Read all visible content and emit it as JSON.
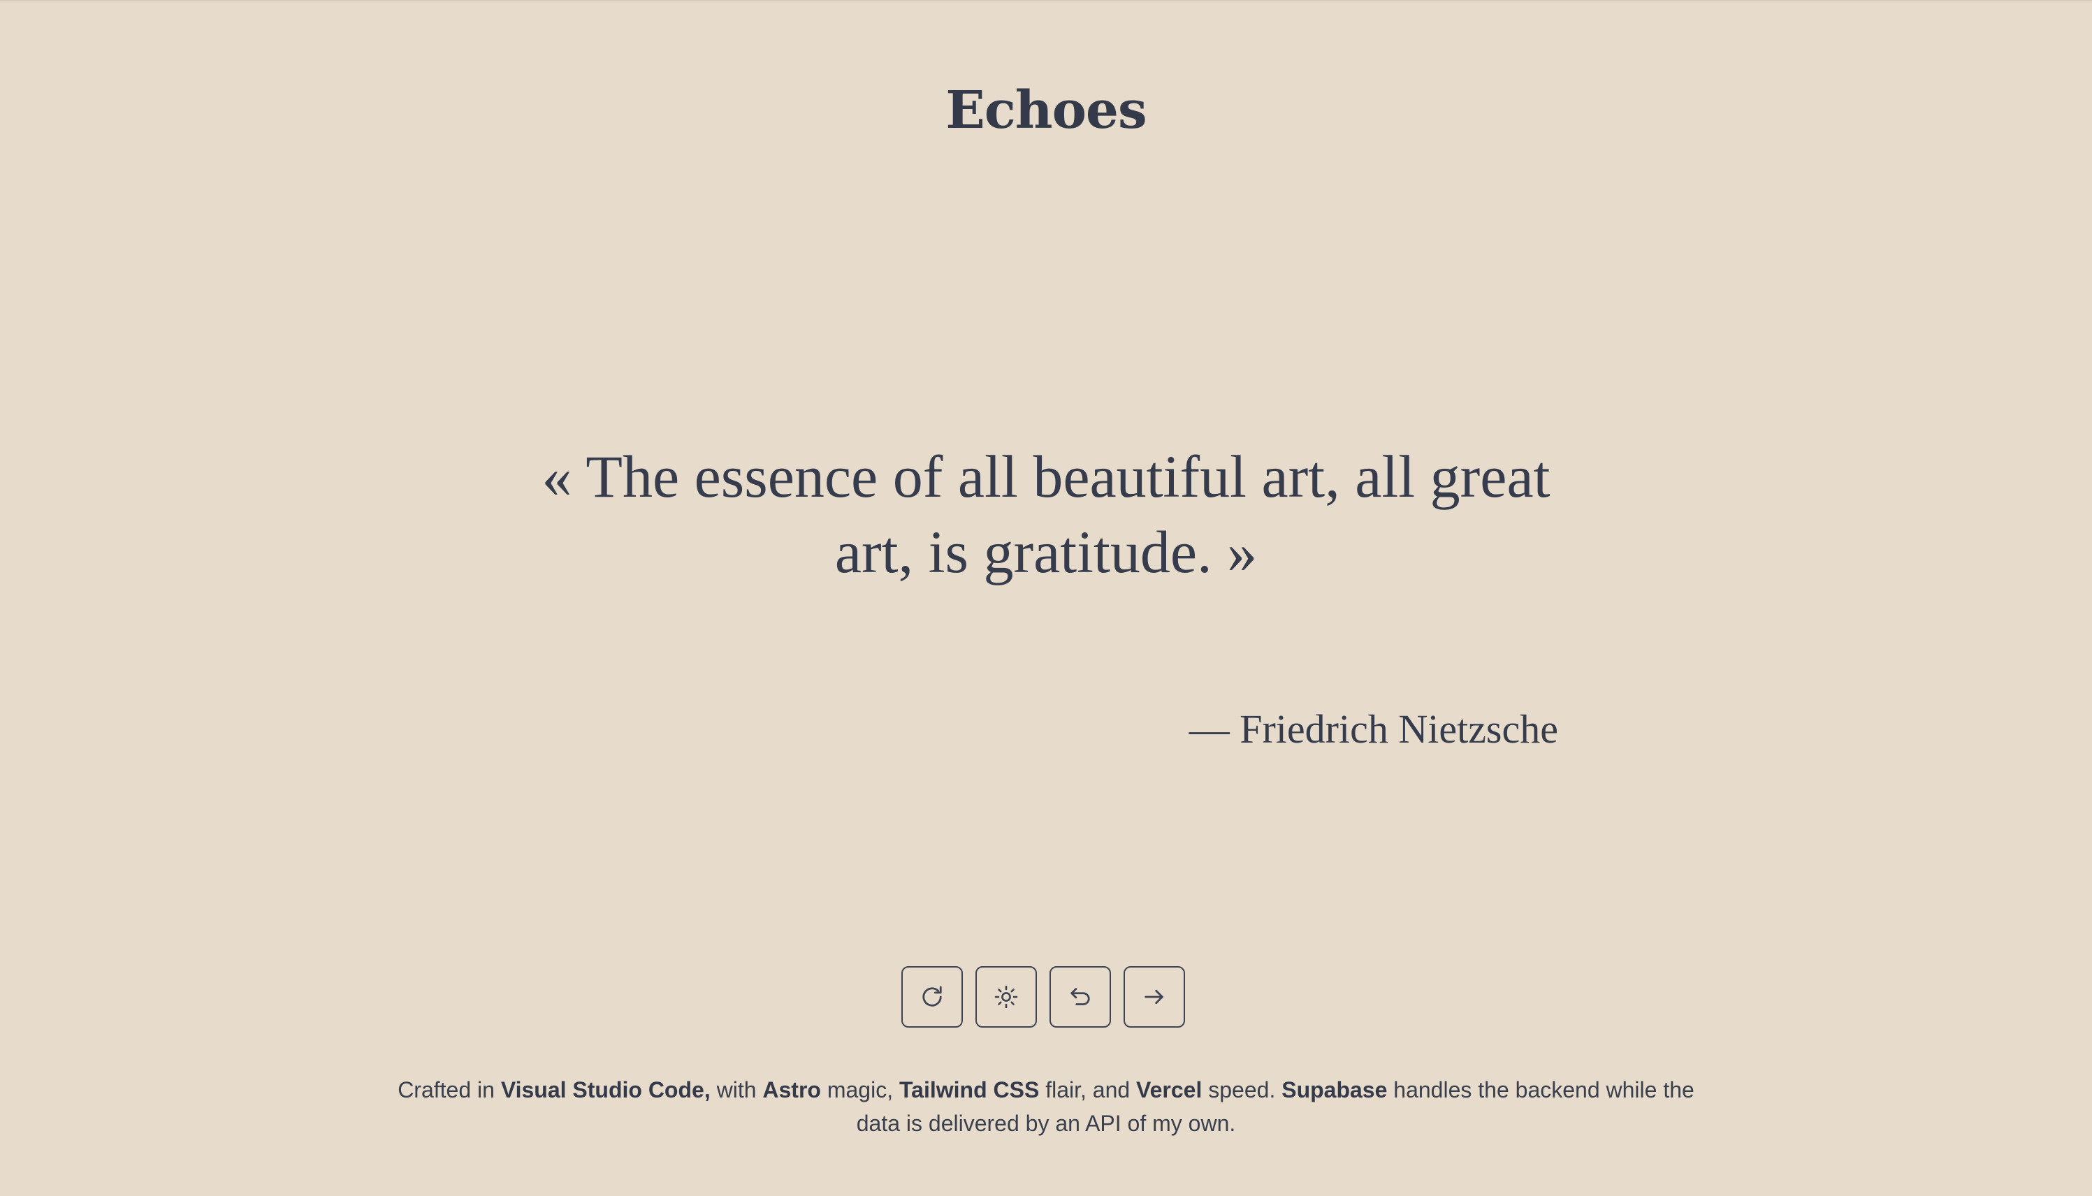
{
  "header": {
    "title": "Echoes"
  },
  "quote": {
    "open_mark": "«",
    "text": "The essence of all beautiful art, all great art, is gratitude.",
    "close_mark": "»",
    "author": "— Friedrich Nietzsche"
  },
  "controls": [
    {
      "icon": "refresh-icon",
      "name": "refresh-button"
    },
    {
      "icon": "sun-icon",
      "name": "theme-toggle-button"
    },
    {
      "icon": "undo-icon",
      "name": "previous-quote-button"
    },
    {
      "icon": "arrow-right-icon",
      "name": "next-quote-button"
    }
  ],
  "footer": {
    "t1": "Crafted in ",
    "b1": "Visual Studio Code,",
    "t2": " with ",
    "b2": "Astro",
    "t3": " magic, ",
    "b3": "Tailwind CSS",
    "t4": " flair, and ",
    "b4": "Vercel",
    "t5": " speed. ",
    "b5": "Supabase",
    "t6": " handles the backend while the data is delivered by an API of my own."
  },
  "colors": {
    "background": "#e7dccb",
    "text": "#343a4a"
  }
}
